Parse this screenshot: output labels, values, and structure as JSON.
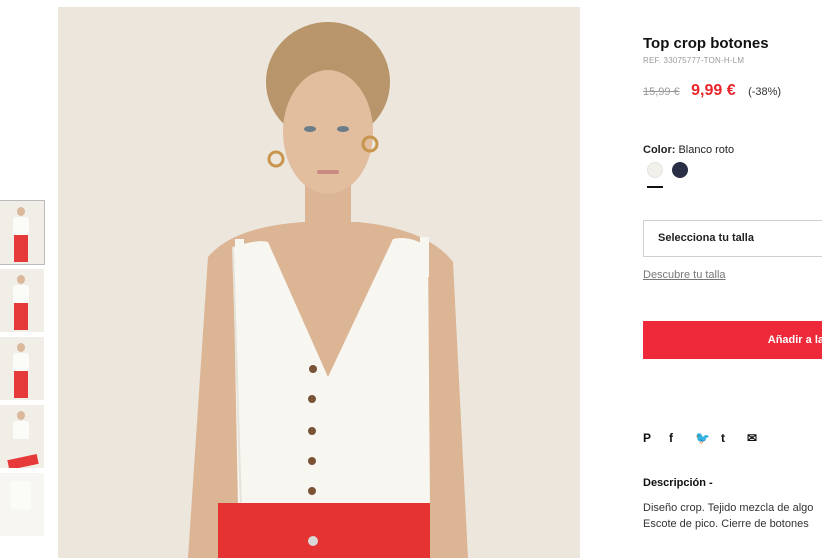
{
  "thumbnails": [
    {
      "label": "Vista frontal"
    },
    {
      "label": "Cuerpo entero"
    },
    {
      "label": "Cuerpo entero 2"
    },
    {
      "label": "Sentada"
    },
    {
      "label": "Prenda sola"
    }
  ],
  "product": {
    "title": "Top crop botones",
    "ref": "REF. 33075777-TON-H-LM",
    "old_price": "15,99 €",
    "new_price": "9,99 €",
    "discount": "(-38%)",
    "color_label": "Color:",
    "color_value": "Blanco roto",
    "colors": [
      "#f1f0ea",
      "#2a2f45"
    ],
    "size_select": "Selecciona tu talla",
    "size_guide": "Descubre tu talla",
    "add_button": "Añadir a la",
    "share_icons": {
      "pinterest": "P",
      "facebook": "f",
      "twitter": "🐦",
      "tumblr": "t",
      "email": "✉"
    },
    "description_title": "Descripción -",
    "description_line1": "Diseño crop. Tejido mezcla de algo",
    "description_line2": "Escote de pico. Cierre de botones"
  },
  "colors": {
    "accent": "#ee2a3a",
    "price": "#e8262c",
    "background_photo": "#ece6dc"
  }
}
